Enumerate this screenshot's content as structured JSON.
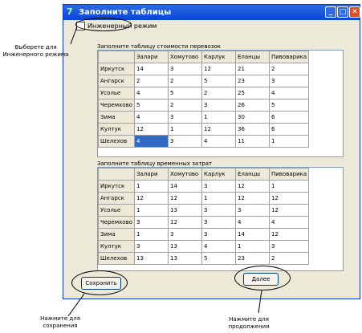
{
  "window": {
    "title": "Заполните таблицы"
  },
  "checkbox": {
    "label": "Инженерный режим"
  },
  "table1": {
    "label": "Заполните таблицу стоимости перевозок",
    "columns": [
      "Залари",
      "Хомутово",
      "Карлук",
      "Еланцы",
      "Пивоварика"
    ],
    "rows": [
      {
        "name": "Иркутск",
        "values": [
          "14",
          "3",
          "12",
          "21",
          "2"
        ]
      },
      {
        "name": "Ангарск",
        "values": [
          "2",
          "2",
          "5",
          "23",
          "3"
        ]
      },
      {
        "name": "Усолье",
        "values": [
          "4",
          "5",
          "2",
          "25",
          "4"
        ]
      },
      {
        "name": "Черемхово",
        "values": [
          "5",
          "2",
          "3",
          "26",
          "5"
        ]
      },
      {
        "name": "Зима",
        "values": [
          "4",
          "3",
          "1",
          "30",
          "6"
        ]
      },
      {
        "name": "Култук",
        "values": [
          "12",
          "1",
          "12",
          "36",
          "6"
        ]
      },
      {
        "name": "Шелехов",
        "values": [
          "4",
          "3",
          "4",
          "11",
          "1"
        ]
      }
    ]
  },
  "table2": {
    "label": "Заполните таблицу временных затрат",
    "columns": [
      "Залари",
      "Хомутово",
      "Карлук",
      "Еланцы",
      "Пивоварика"
    ],
    "rows": [
      {
        "name": "Иркутск",
        "values": [
          "1",
          "14",
          "3",
          "12",
          "1"
        ]
      },
      {
        "name": "Ангарск",
        "values": [
          "12",
          "12",
          "1",
          "12",
          "12"
        ]
      },
      {
        "name": "Усолье",
        "values": [
          "1",
          "13",
          "3",
          "3",
          "12"
        ]
      },
      {
        "name": "Черемхово",
        "values": [
          "3",
          "12",
          "3",
          "4",
          "4"
        ]
      },
      {
        "name": "Зима",
        "values": [
          "1",
          "3",
          "3",
          "14",
          "12"
        ]
      },
      {
        "name": "Култук",
        "values": [
          "3",
          "13",
          "4",
          "1",
          "3"
        ]
      },
      {
        "name": "Шелехов",
        "values": [
          "13",
          "13",
          "5",
          "23",
          "2"
        ]
      }
    ]
  },
  "buttons": {
    "save": "Сохранить",
    "next": "Далее"
  },
  "callouts": {
    "engineer": "Выберете для Инженерного режима",
    "save": "Нажмите для сохранения",
    "next": "Нажмите для продолжения"
  }
}
